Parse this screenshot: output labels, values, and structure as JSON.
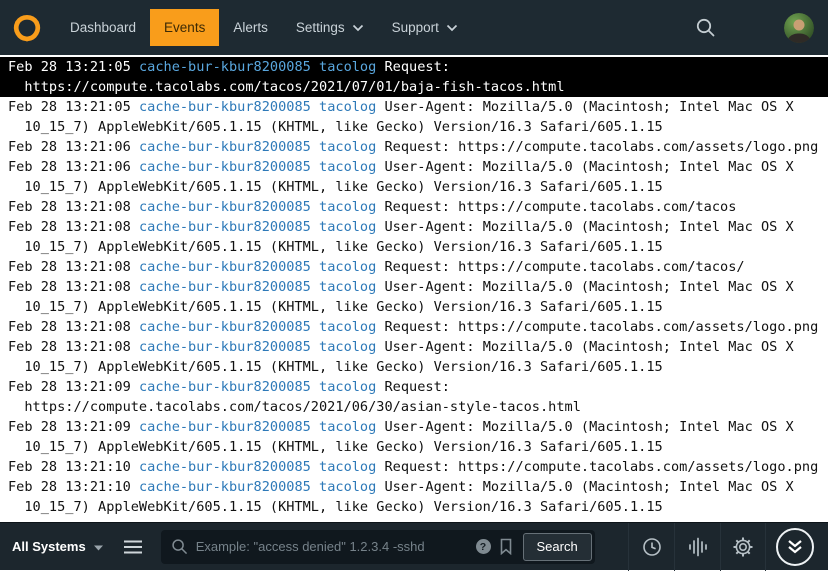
{
  "nav": {
    "items": [
      {
        "label": "Dashboard",
        "active": false
      },
      {
        "label": "Events",
        "active": true
      },
      {
        "label": "Alerts",
        "active": false
      },
      {
        "label": "Settings",
        "active": false,
        "has_caret": true
      },
      {
        "label": "Support",
        "active": false,
        "has_caret": true
      }
    ]
  },
  "log": {
    "events": [
      {
        "time": "Feb 28 13:21:05",
        "host": "cache-bur-kbur8200085",
        "program": "tacolog",
        "message": "Request: https://compute.tacolabs.com/tacos/2021/07/01/baja-fish-tacos.html",
        "highlighted": true
      },
      {
        "time": "Feb 28 13:21:05",
        "host": "cache-bur-kbur8200085",
        "program": "tacolog",
        "message": "User-Agent: Mozilla/5.0 (Macintosh; Intel Mac OS X 10_15_7) AppleWebKit/605.1.15 (KHTML, like Gecko) Version/16.3 Safari/605.1.15",
        "highlighted": false
      },
      {
        "time": "Feb 28 13:21:06",
        "host": "cache-bur-kbur8200085",
        "program": "tacolog",
        "message": "Request: https://compute.tacolabs.com/assets/logo.png",
        "highlighted": false
      },
      {
        "time": "Feb 28 13:21:06",
        "host": "cache-bur-kbur8200085",
        "program": "tacolog",
        "message": "User-Agent: Mozilla/5.0 (Macintosh; Intel Mac OS X 10_15_7) AppleWebKit/605.1.15 (KHTML, like Gecko) Version/16.3 Safari/605.1.15",
        "highlighted": false
      },
      {
        "time": "Feb 28 13:21:08",
        "host": "cache-bur-kbur8200085",
        "program": "tacolog",
        "message": "Request: https://compute.tacolabs.com/tacos",
        "highlighted": false
      },
      {
        "time": "Feb 28 13:21:08",
        "host": "cache-bur-kbur8200085",
        "program": "tacolog",
        "message": "User-Agent: Mozilla/5.0 (Macintosh; Intel Mac OS X 10_15_7) AppleWebKit/605.1.15 (KHTML, like Gecko) Version/16.3 Safari/605.1.15",
        "highlighted": false
      },
      {
        "time": "Feb 28 13:21:08",
        "host": "cache-bur-kbur8200085",
        "program": "tacolog",
        "message": "Request: https://compute.tacolabs.com/tacos/",
        "highlighted": false
      },
      {
        "time": "Feb 28 13:21:08",
        "host": "cache-bur-kbur8200085",
        "program": "tacolog",
        "message": "User-Agent: Mozilla/5.0 (Macintosh; Intel Mac OS X 10_15_7) AppleWebKit/605.1.15 (KHTML, like Gecko) Version/16.3 Safari/605.1.15",
        "highlighted": false
      },
      {
        "time": "Feb 28 13:21:08",
        "host": "cache-bur-kbur8200085",
        "program": "tacolog",
        "message": "Request: https://compute.tacolabs.com/assets/logo.png",
        "highlighted": false
      },
      {
        "time": "Feb 28 13:21:08",
        "host": "cache-bur-kbur8200085",
        "program": "tacolog",
        "message": "User-Agent: Mozilla/5.0 (Macintosh; Intel Mac OS X 10_15_7) AppleWebKit/605.1.15 (KHTML, like Gecko) Version/16.3 Safari/605.1.15",
        "highlighted": false
      },
      {
        "time": "Feb 28 13:21:09",
        "host": "cache-bur-kbur8200085",
        "program": "tacolog",
        "message": "Request: https://compute.tacolabs.com/tacos/2021/06/30/asian-style-tacos.html",
        "highlighted": false
      },
      {
        "time": "Feb 28 13:21:09",
        "host": "cache-bur-kbur8200085",
        "program": "tacolog",
        "message": "User-Agent: Mozilla/5.0 (Macintosh; Intel Mac OS X 10_15_7) AppleWebKit/605.1.15 (KHTML, like Gecko) Version/16.3 Safari/605.1.15",
        "highlighted": false
      },
      {
        "time": "Feb 28 13:21:10",
        "host": "cache-bur-kbur8200085",
        "program": "tacolog",
        "message": "Request: https://compute.tacolabs.com/assets/logo.png",
        "highlighted": false
      },
      {
        "time": "Feb 28 13:21:10",
        "host": "cache-bur-kbur8200085",
        "program": "tacolog",
        "message": "User-Agent: Mozilla/5.0 (Macintosh; Intel Mac OS X 10_15_7) AppleWebKit/605.1.15 (KHTML, like Gecko) Version/16.3 Safari/605.1.15",
        "highlighted": false
      }
    ]
  },
  "footer": {
    "system_selector_label": "All Systems",
    "search_placeholder": "Example: \"access denied\" 1.2.3.4 -sshd",
    "search_button_label": "Search",
    "help_icon_glyph": "?"
  },
  "colors": {
    "accent_orange": "#f99d1b",
    "link_blue": "#2d79b8",
    "nav_bg": "#1e2a32",
    "footer_bg": "#1c262d",
    "highlight_bg": "#000000"
  }
}
